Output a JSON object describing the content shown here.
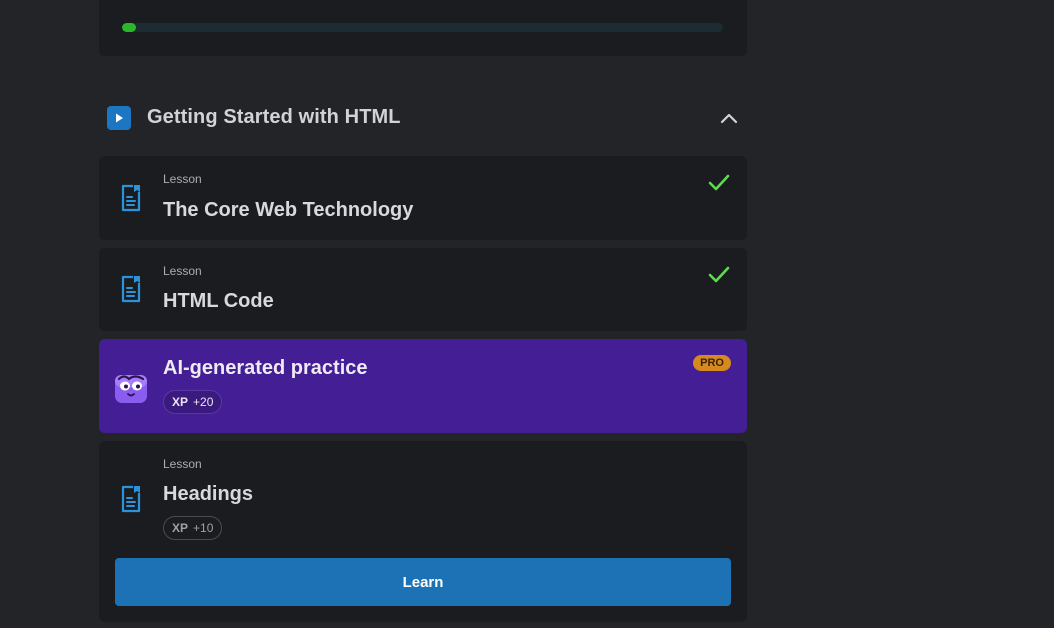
{
  "progress": {
    "fraction": 0.02,
    "fill_color": "#2bb72b"
  },
  "section": {
    "title": "Getting Started with HTML",
    "icon": "play-icon",
    "toggle_icon": "chevron-up-icon"
  },
  "lessons": [
    {
      "type": "Lesson",
      "title": "The Core Web Technology",
      "completed": true,
      "icon": "document-icon"
    },
    {
      "type": "Lesson",
      "title": "HTML Code",
      "completed": true,
      "icon": "document-icon"
    }
  ],
  "ai_practice": {
    "title": "AI-generated practice",
    "badge": "PRO",
    "xp_label": "XP",
    "xp_value": "+20",
    "icon": "mascot-icon",
    "background": "#441e94"
  },
  "current_lesson": {
    "type": "Lesson",
    "title": "Headings",
    "xp_label": "XP",
    "xp_value": "+10",
    "icon": "document-icon",
    "button_label": "Learn"
  },
  "colors": {
    "accent": "#1c72b4",
    "check": "#5fd94f",
    "pro": "#d6891f"
  }
}
